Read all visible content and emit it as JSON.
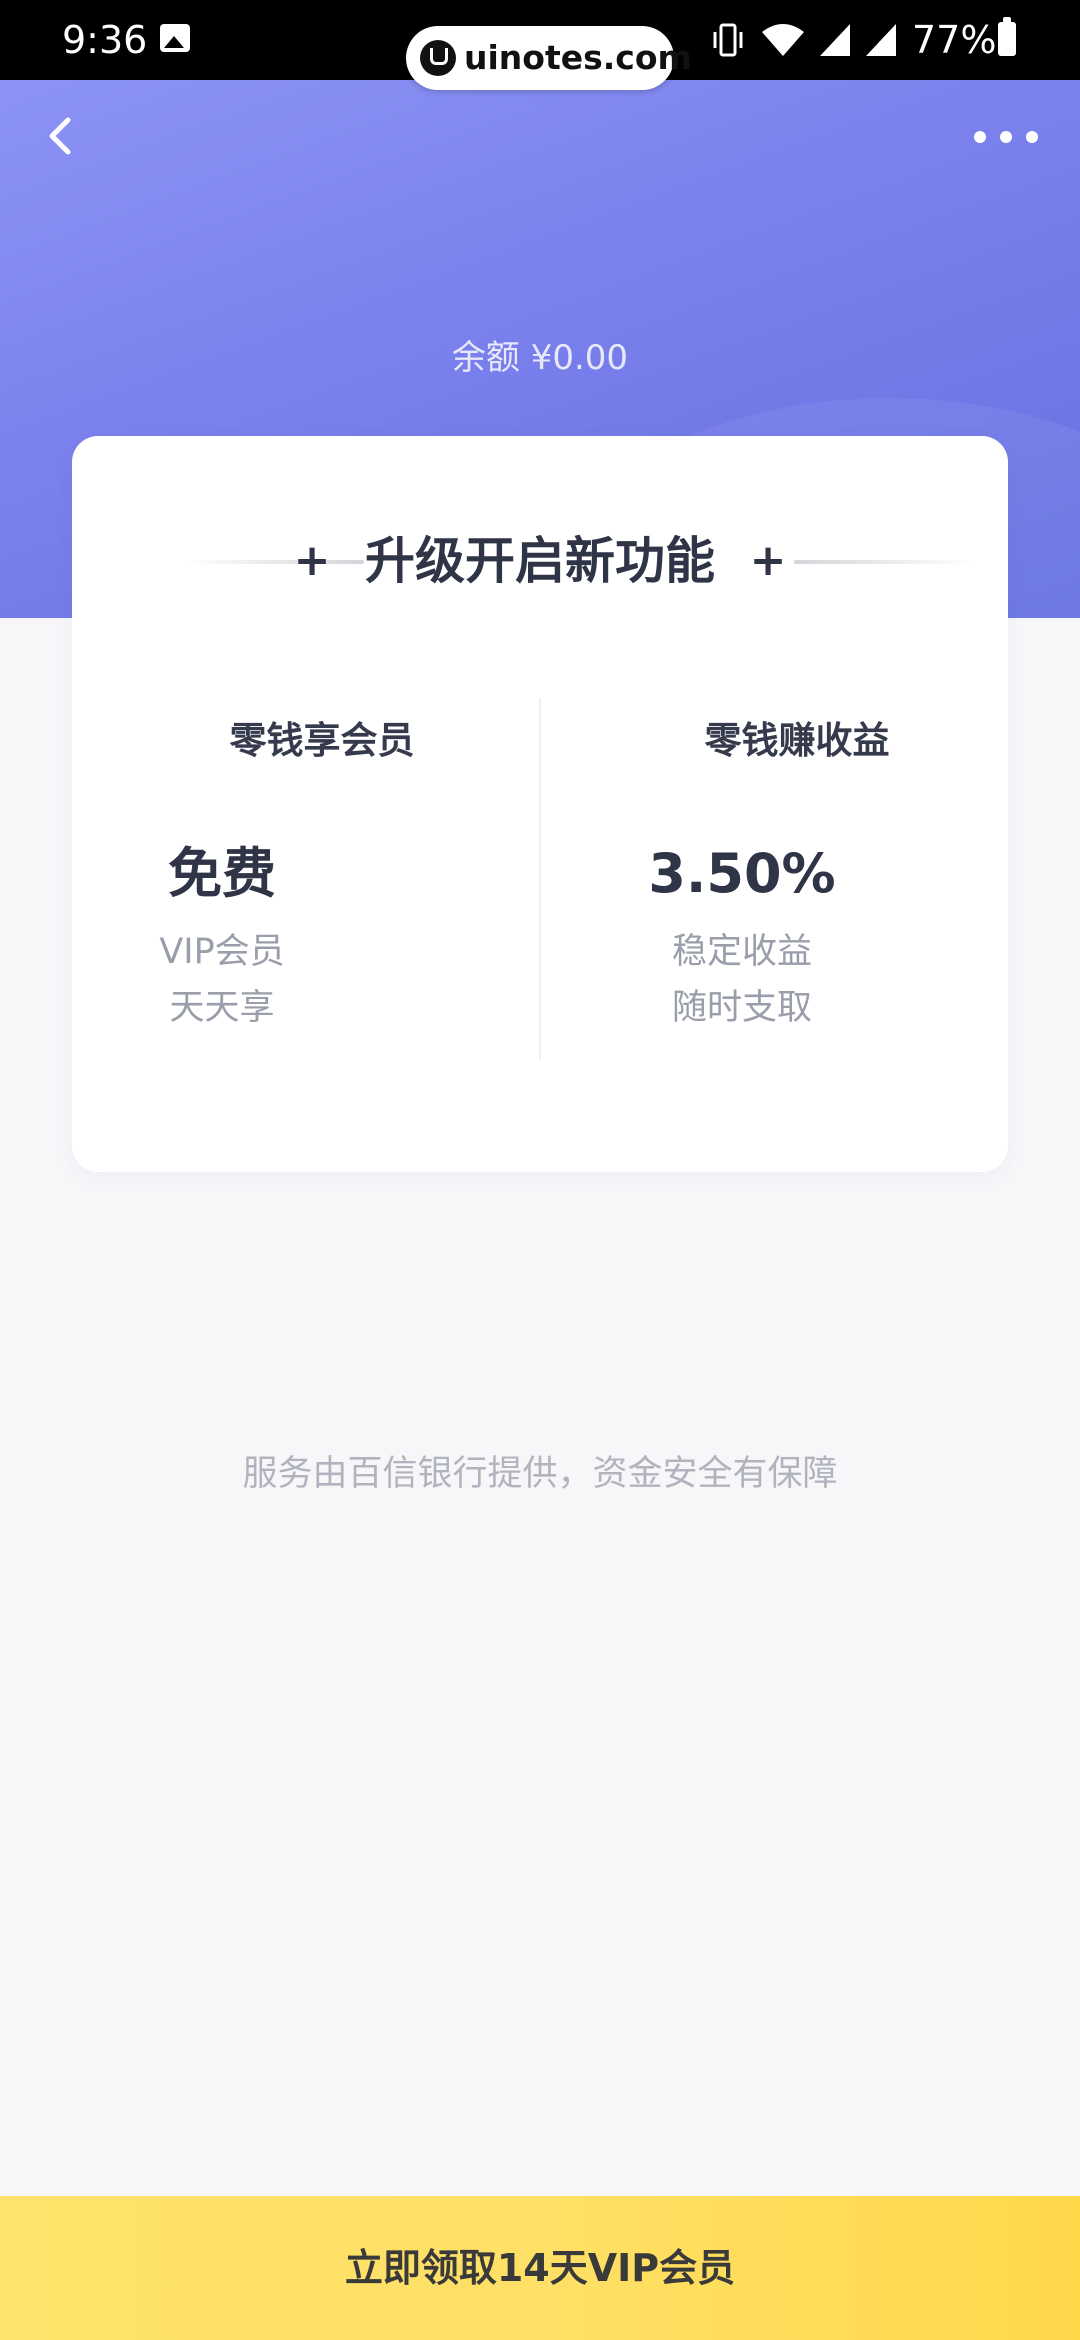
{
  "status_bar": {
    "time": "9:36",
    "battery": "77%",
    "watermark": "uinotes.com"
  },
  "header": {
    "balance": "余额 ¥0.00",
    "icons": {
      "back": "chevron-left-icon",
      "more": "more-dots-icon"
    }
  },
  "card": {
    "title": "升级开启新功能",
    "left": {
      "heading": "零钱享会员",
      "value": "免费",
      "desc_line1": "VIP会员",
      "desc_line2": "天天享"
    },
    "right": {
      "heading": "零钱赚收益",
      "value": "3.50%",
      "desc_line1": "稳定收益",
      "desc_line2": "随时支取"
    }
  },
  "footer_note": "服务由百信银行提供，资金安全有保障",
  "cta": {
    "label": "立即领取14天VIP会员"
  },
  "colors": {
    "header_gradient_start": "#8c93f5",
    "header_gradient_end": "#6670e2",
    "cta_yellow": "#ffe066",
    "title_text": "#2f3447",
    "muted_text": "#9a9eab"
  }
}
